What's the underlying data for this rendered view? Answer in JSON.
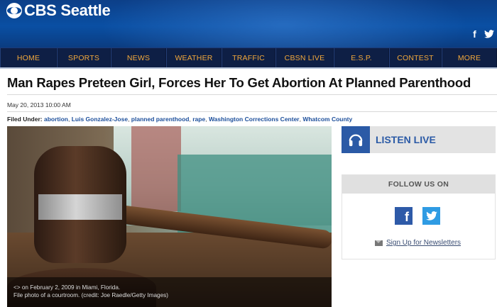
{
  "header": {
    "logo_text": "CBS Seattle",
    "social": [
      "f",
      "🐦"
    ]
  },
  "nav": {
    "items": [
      "HOME",
      "SPORTS",
      "NEWS",
      "WEATHER",
      "TRAFFIC",
      "CBSN LIVE",
      "E.S.P.",
      "CONTEST",
      "MORE"
    ]
  },
  "article": {
    "headline": "Man Rapes Preteen Girl, Forces Her To Get Abortion At Planned Parenthood",
    "date": "May 20, 2013 10:00 AM",
    "filed_label": "Filed Under:",
    "tags": [
      "abortion",
      "Luis Gonzalez-Jose",
      "planned parenthood",
      "rape",
      "Washington Corrections Center",
      "Whatcom County"
    ],
    "photo_caption_line1": "<> on February 2, 2009 in Miami, Florida.",
    "photo_caption_line2": "File photo of a courtroom. (credit: Joe Raedle/Getty Images)"
  },
  "sidebar": {
    "listen_live": "LISTEN LIVE",
    "follow_us": "FOLLOW US ON",
    "newsletter": "Sign Up for Newsletters"
  },
  "colors": {
    "brand_blue": "#0a4fa3",
    "nav_bg": "#0e1f45",
    "nav_text": "#f2a83b",
    "link_blue": "#1d4f9b",
    "facebook": "#2e5aa8",
    "twitter": "#2f9be3"
  }
}
